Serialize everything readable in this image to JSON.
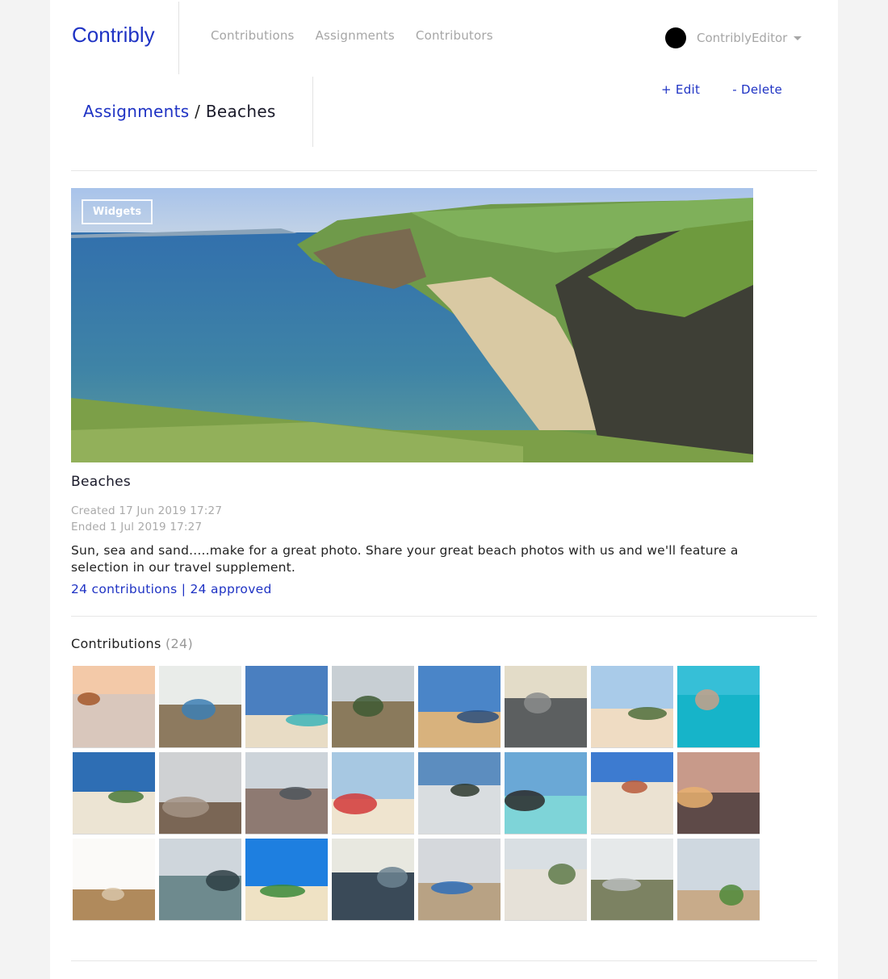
{
  "app": {
    "logo": "Contribly",
    "nav": [
      "Contributions",
      "Assignments",
      "Contributors"
    ],
    "user": {
      "name": "ContriblyEditor",
      "avatar_color": "#000000"
    },
    "accent_color": "#1f33c4"
  },
  "breadcrumb": {
    "parent": "Assignments",
    "separator": "/",
    "current": "Beaches"
  },
  "actions": {
    "edit": "+ Edit",
    "delete": "- Delete"
  },
  "assignment": {
    "badge": "Widgets",
    "hero_image": "coastal cliffs overlooking a sandy cove",
    "title": "Beaches",
    "created": "Created 17 Jun 2019 17:27",
    "ended": "Ended 1 Jul 2019 17:27",
    "description": "Sun, sea and sand.....make for a great photo. Share your great beach photos with us and we'll feature a selection in our travel supplement.",
    "contributions_link": "24 contributions",
    "stats_separator": "|",
    "approved_link": "24 approved"
  },
  "contributions": {
    "heading": "Contributions",
    "count": "(24)",
    "thumbnails": [
      {
        "alt": "sunset behind sea stack",
        "sky": "#f3c9a8",
        "ground": "#d9c7bc",
        "accent": "#a4582a"
      },
      {
        "alt": "boats in harbour at low tide",
        "sky": "#e9ece9",
        "ground": "#8d7a5f",
        "accent": "#3c7fb4"
      },
      {
        "alt": "couple on beach swing",
        "sky": "#4a7fc0",
        "ground": "#e8dcc5",
        "accent": "#3db5b8"
      },
      {
        "alt": "person sitting on dunes",
        "sky": "#c8cfd4",
        "ground": "#8a7a5c",
        "accent": "#3e5a32"
      },
      {
        "alt": "beach promenade",
        "sky": "#4a85c8",
        "ground": "#d8b27d",
        "accent": "#2a4d7d"
      },
      {
        "alt": "grey sea horizon",
        "sky": "#e3dcc8",
        "ground": "#5c5f60",
        "accent": "#8a8c8c"
      },
      {
        "alt": "woman on sandy beach with island",
        "sky": "#a9cbe9",
        "ground": "#efdcc3",
        "accent": "#4f6e3c"
      },
      {
        "alt": "turquoise cove with cliffs",
        "sky": "#36bfd7",
        "ground": "#16b4c9",
        "accent": "#c8a088"
      },
      {
        "alt": "palm tree on white beach",
        "sky": "#2e6eb4",
        "ground": "#ece4d3",
        "accent": "#4c7a3a"
      },
      {
        "alt": "wet sand at low tide",
        "sky": "#cfd1d3",
        "ground": "#7a6655",
        "accent": "#a39385"
      },
      {
        "alt": "surfer walking on flat beach",
        "sky": "#cdd4da",
        "ground": "#8e7a72",
        "accent": "#4f565c"
      },
      {
        "alt": "woman in red on beach",
        "sky": "#a7c8e2",
        "ground": "#efe4cf",
        "accent": "#d23a3a"
      },
      {
        "alt": "tree branches over shore",
        "sky": "#5c8dbf",
        "ground": "#d9dde0",
        "accent": "#2e3a2e"
      },
      {
        "alt": "swimmer in clear water",
        "sky": "#6aa8d6",
        "ground": "#7ed4d8",
        "accent": "#2a2a2a"
      },
      {
        "alt": "iguana on tropical beach",
        "sky": "#3d7bd0",
        "ground": "#ebe2d2",
        "accent": "#b85a3c"
      },
      {
        "alt": "sunset over rocky shore",
        "sky": "#c89a8a",
        "ground": "#5e4a48",
        "accent": "#e8b070"
      },
      {
        "alt": "sandy path through dunes",
        "sky": "#fbfaf8",
        "ground": "#b08a5c",
        "accent": "#d8c4a8"
      },
      {
        "alt": "kite surfers on estuary",
        "sky": "#cfd6dc",
        "ground": "#6e8a8e",
        "accent": "#2e3e44"
      },
      {
        "alt": "trees over tropical beach",
        "sky": "#1e7fe0",
        "ground": "#efe2c4",
        "accent": "#3b8a3a"
      },
      {
        "alt": "waves rolling in",
        "sky": "#e8e8e0",
        "ground": "#3a4a58",
        "accent": "#6c8290"
      },
      {
        "alt": "colourful beach huts",
        "sky": "#d5d8dc",
        "ground": "#b8a284",
        "accent": "#2f6fb8"
      },
      {
        "alt": "blurry beach waves",
        "sky": "#d9dfe3",
        "ground": "#e6e1d8",
        "accent": "#5e7a4a"
      },
      {
        "alt": "dune grass and sea",
        "sky": "#e6e9ea",
        "ground": "#7c8262",
        "accent": "#b8bcbc"
      },
      {
        "alt": "wooden boardwalk to beach",
        "sky": "#cfd8e0",
        "ground": "#c8ab8a",
        "accent": "#4f8a3a"
      }
    ]
  }
}
